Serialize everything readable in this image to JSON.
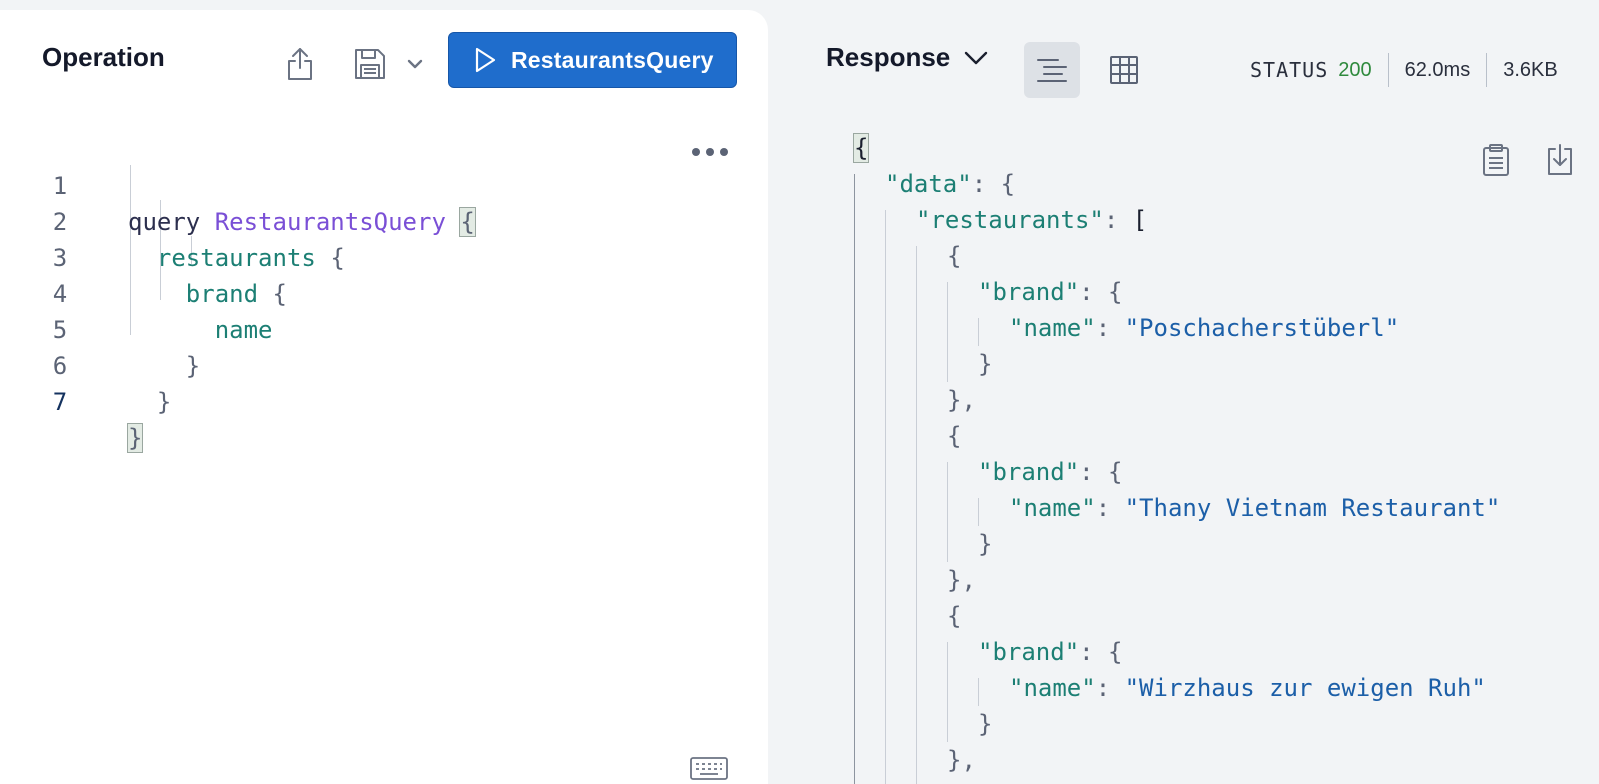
{
  "operation": {
    "title": "Operation",
    "run_label": "RestaurantsQuery",
    "icons": {
      "share": "share-icon",
      "save": "save-icon",
      "caret": "chevron-down-icon",
      "run": "play-icon",
      "more": "more-icon",
      "keyboard": "keyboard-icon"
    },
    "line_numbers": [
      "1",
      "2",
      "3",
      "4",
      "5",
      "6",
      "7"
    ],
    "code": {
      "keyword": "query",
      "op_name": "RestaurantsQuery",
      "open_brace": "{",
      "l2_field": "restaurants",
      "l2_brace": "{",
      "l3_field": "brand",
      "l3_brace": "{",
      "l4_field": "name",
      "l5_close": "}",
      "l6_close": "}",
      "l7_close": "}"
    }
  },
  "response": {
    "title": "Response",
    "status_label": "STATUS",
    "status_code": "200",
    "time": "62.0ms",
    "size": "3.6KB",
    "status_code_color": "#2f8a3d",
    "icons": {
      "caret": "chevron-down-icon",
      "text_view": "text-view-icon",
      "table_view": "table-view-icon",
      "copy": "clipboard-icon",
      "download": "download-icon"
    },
    "json": {
      "open": "{",
      "data_key": "\"data\"",
      "restaurants_key": "\"restaurants\"",
      "brand_key": "\"brand\"",
      "name_key": "\"name\"",
      "names": [
        "\"Poschacherstüberl\"",
        "\"Thany Vietnam Restaurant\"",
        "\"Wirzhaus zur ewigen Ruh\""
      ]
    }
  }
}
